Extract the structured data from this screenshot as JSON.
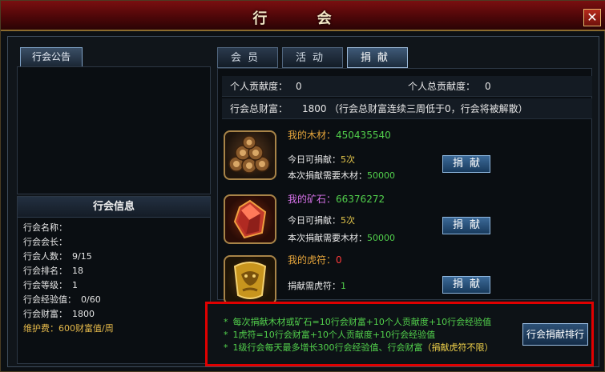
{
  "window": {
    "title": "行 会",
    "close_label": "✕"
  },
  "left": {
    "notice_tab": "行会公告",
    "info_title": "行会信息",
    "info_rows": [
      {
        "label": "行会名称：",
        "value": ""
      },
      {
        "label": "行会会长：",
        "value": ""
      },
      {
        "label": "行会人数：",
        "value": "9/15"
      },
      {
        "label": "行会排名：",
        "value": "18"
      },
      {
        "label": "行会等级：",
        "value": "1"
      },
      {
        "label": "行会经验值：",
        "value": "0/60"
      },
      {
        "label": "行会财富：",
        "value": "1800"
      }
    ],
    "upkeep": "维护费：600财富值/周"
  },
  "tabs": [
    "会员",
    "活动",
    "捐献"
  ],
  "active_tab": "捐献",
  "stats": {
    "personal_contrib_label": "个人贡献度：",
    "personal_contrib_value": "0",
    "personal_total_label": "个人总贡献度：",
    "personal_total_value": "0",
    "guild_wealth_label": "行会总财富：",
    "guild_wealth_value": "1800",
    "guild_wealth_note": "（行会总财富连续三周低于0，行会将被解散）"
  },
  "resources": [
    {
      "name_label": "我的木材：",
      "amount": "450435540",
      "line1_label": "今日可捐献：",
      "line1_value": "5次",
      "line2_label": "本次捐献需要木材：",
      "line2_value": "50000",
      "button": "捐献"
    },
    {
      "name_label": "我的矿石：",
      "amount": "66376272",
      "line1_label": "今日可捐献：",
      "line1_value": "5次",
      "line2_label": "本次捐献需要木材：",
      "line2_value": "50000",
      "button": "捐献"
    },
    {
      "name_label": "我的虎符：",
      "amount": "0",
      "line1_label": "捐献需虎符：",
      "line1_value": "1",
      "button": "捐献"
    }
  ],
  "tips": {
    "line1": "每次捐献木材或矿石=10行会财富+10个人贡献度+10行会经验值",
    "line2": "1虎符=10行会财富+10个人贡献度+10行会经验值",
    "line3_main": "1级行会每天最多增长300行会经验值、行会财富",
    "line3_highlight": "（捐献虎符不限）",
    "rank_button": "行会捐献排行"
  },
  "colors": {
    "accent_red": "#e00000",
    "green_text": "#52d14c",
    "gold_text": "#e3a33a"
  }
}
